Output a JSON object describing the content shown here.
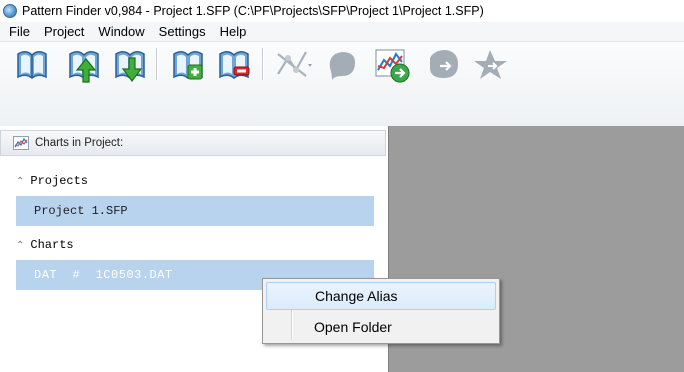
{
  "window": {
    "title": "Pattern Finder v0,984 - Project 1.SFP (C:\\PF\\Projects\\SFP\\Project 1\\Project 1.SFP)"
  },
  "menu": {
    "items": [
      "File",
      "Project",
      "Window",
      "Settings",
      "Help"
    ]
  },
  "toolbar": {
    "buttons": [
      {
        "icon": "open-book-icon"
      },
      {
        "icon": "book-upload-icon"
      },
      {
        "icon": "book-download-icon"
      },
      {
        "icon": "book-add-icon"
      },
      {
        "icon": "book-remove-icon"
      },
      {
        "icon": "pattern-lines-icon"
      },
      {
        "icon": "blob-icon"
      },
      {
        "icon": "chart-export-icon"
      },
      {
        "icon": "shape-export-icon"
      },
      {
        "icon": "star-export-icon"
      }
    ]
  },
  "left_panel": {
    "header": "Charts in Project:",
    "sections": [
      {
        "title": "Projects",
        "items": [
          "Project 1.SFP"
        ]
      },
      {
        "title": "Charts",
        "items": [
          "DAT  #  1C0503.DAT"
        ]
      }
    ]
  },
  "context_menu": {
    "items": [
      "Change Alias",
      "Open Folder"
    ]
  },
  "colors": {
    "selection": "#b8d3ee",
    "workspace": "#9c9c9c",
    "menu_hover_border": "#aecff1"
  }
}
